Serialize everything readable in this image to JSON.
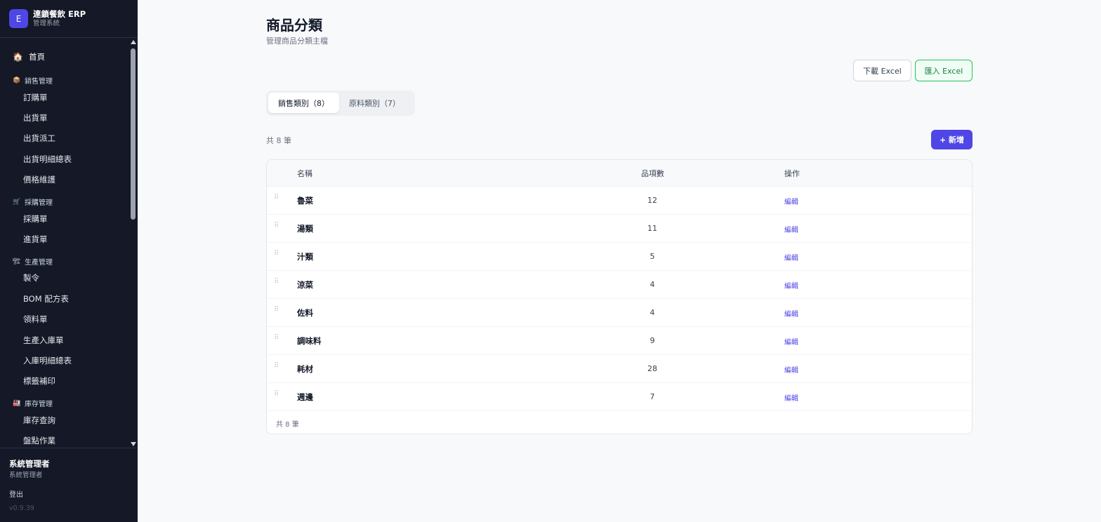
{
  "sidebar": {
    "brand": {
      "logo_letter": "E",
      "name": "連鎖餐飲 ERP",
      "subtitle": "管理系統"
    },
    "home": {
      "icon": "🏠",
      "label": "首頁"
    },
    "groups": [
      {
        "icon": "📦",
        "label": "銷售管理",
        "items": [
          "訂購單",
          "出貨單",
          "出貨派工",
          "出貨明細總表",
          "價格維護"
        ]
      },
      {
        "icon": "🛒",
        "label": "採購管理",
        "items": [
          "採購單",
          "進貨單"
        ]
      },
      {
        "icon": "🏗",
        "label": "生產管理",
        "items": [
          "製令",
          "BOM 配方表",
          "領料單",
          "生產入庫單",
          "入庫明細總表",
          "標籤補印"
        ]
      },
      {
        "icon": "🏭",
        "label": "庫存管理",
        "items": [
          "庫存查詢",
          "盤點作業"
        ]
      }
    ],
    "user": {
      "name": "系統管理者",
      "role": "系統管理者"
    },
    "logout_label": "登出",
    "version": "v0.9.39"
  },
  "page": {
    "title": "商品分類",
    "subtitle": "管理商品分類主檔"
  },
  "actions": {
    "download_label": "下載 Excel",
    "import_label": "匯入 Excel",
    "add_label": "+ 新增"
  },
  "tabs": [
    {
      "label": "銷售類別（8）",
      "active": true
    },
    {
      "label": "原料類別（7）",
      "active": false
    }
  ],
  "table": {
    "count_label": "共 8 筆",
    "columns": {
      "name": "名稱",
      "count": "品項數",
      "ops": "操作"
    },
    "rows": [
      {
        "name": "魯菜",
        "count": "12",
        "edit": "編輯"
      },
      {
        "name": "湯類",
        "count": "11",
        "edit": "編輯"
      },
      {
        "name": "汁類",
        "count": "5",
        "edit": "編輯"
      },
      {
        "name": "涼菜",
        "count": "4",
        "edit": "編輯"
      },
      {
        "name": "佐料",
        "count": "4",
        "edit": "編輯"
      },
      {
        "name": "調味料",
        "count": "9",
        "edit": "編輯"
      },
      {
        "name": "耗材",
        "count": "28",
        "edit": "編輯"
      },
      {
        "name": "週邊",
        "count": "7",
        "edit": "編輯"
      }
    ],
    "footer_label": "共 8 筆"
  },
  "colors": {
    "sidebar_bg": "#141827",
    "accent": "#4f46e5",
    "import_green": "#15803d"
  }
}
